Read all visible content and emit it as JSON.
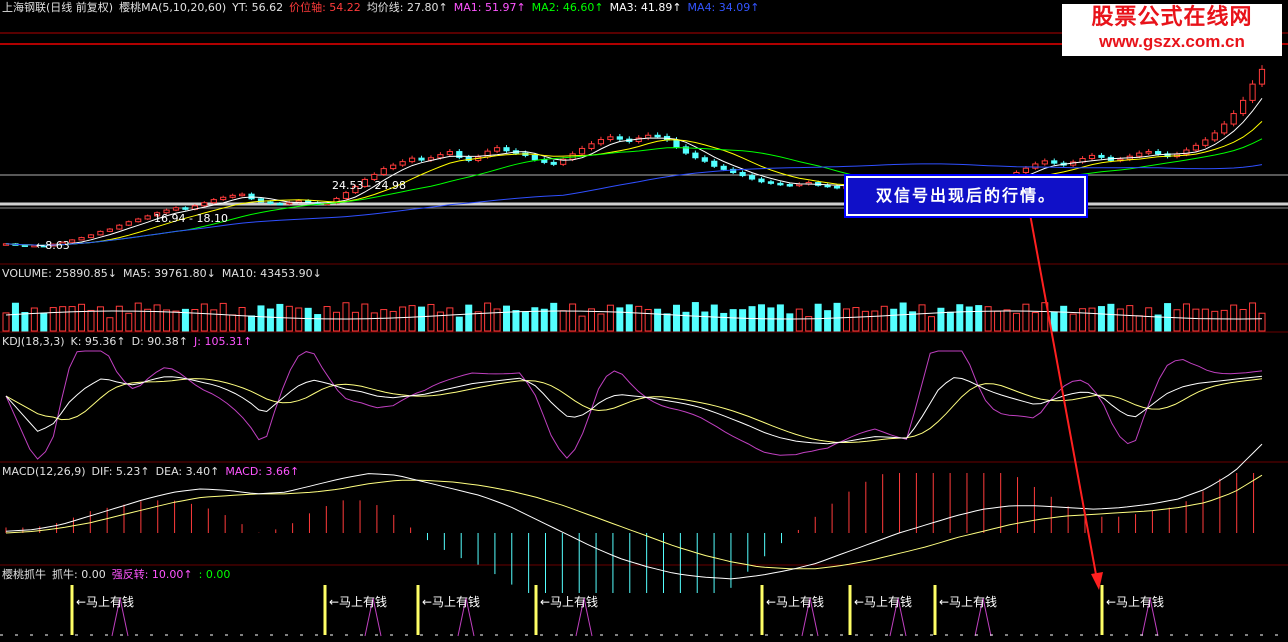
{
  "main_header": {
    "stock": "上海钢联(日线 前复权)",
    "ma_name": "樱桃MA(5,10,20,60)",
    "yt": "YT: 56.62",
    "price_axis": "价位轴: 54.22",
    "avg_line": "均价线: 27.80↑",
    "ma1": "MA1: 51.97↑",
    "ma2": "MA2: 46.60↑",
    "ma3": "MA3: 41.89↑",
    "ma4": "MA4: 34.09↑"
  },
  "price_labels": {
    "low": "←8.63",
    "box1": "16.94 - 18.10",
    "box2": "24.53 - 24.98"
  },
  "volume_header": {
    "name": "VOLUME: 25890.85↓",
    "ma5": "MA5: 39761.80↓",
    "ma10": "MA10: 43453.90↓"
  },
  "kdj_header": {
    "name": "KDJ(18,3,3)",
    "k": "K: 95.36↑",
    "d": "D: 90.38↑",
    "j": "J: 105.31↑"
  },
  "macd_header": {
    "name": "MACD(12,26,9)",
    "dif": "DIF: 5.23↑",
    "dea": "DEA: 3.40↑",
    "macd": "MACD: 3.66↑"
  },
  "signal_header": {
    "name": "樱桃抓牛",
    "zhuaniu": "抓牛: 0.00",
    "qiangfanzhuan": "强反转: 10.00↑",
    "extra": ": 0.00"
  },
  "signal_label": "←马上有钱",
  "callout": "双信号出现后的行情。",
  "watermark": {
    "line1": "股票公式在线网",
    "line2": "www.gszx.com.cn"
  },
  "colors": {
    "up": "#ff3b3b",
    "down": "#54ffff",
    "ma1": "#ffffff",
    "ma2": "#ffff00",
    "ma3": "#00ff00",
    "ma4": "#2f4fff",
    "axis": "#8b0000",
    "macd_pos": "#ff3b3b",
    "macd_neg": "#54ffff",
    "signal": "#ffff66",
    "kdj_j": "#c040c0"
  },
  "chart_data": {
    "type": "candlestick",
    "price_series_close": [
      9.2,
      8.9,
      8.7,
      8.8,
      8.63,
      9.1,
      9.6,
      10.2,
      10.8,
      11.5,
      12.4,
      13.0,
      14.0,
      14.9,
      15.6,
      16.4,
      17.2,
      17.9,
      18.5,
      18.1,
      19.0,
      19.8,
      20.6,
      21.2,
      21.7,
      22.0,
      20.8,
      20.0,
      19.6,
      19.5,
      19.9,
      20.3,
      19.8,
      19.4,
      19.7,
      20.9,
      22.4,
      24.0,
      25.8,
      27.1,
      28.6,
      29.5,
      30.4,
      31.3,
      30.8,
      31.4,
      32.2,
      33.0,
      31.5,
      30.7,
      31.6,
      33.1,
      34.0,
      33.2,
      32.6,
      32.0,
      30.9,
      30.2,
      29.7,
      31.0,
      32.4,
      33.8,
      35.0,
      36.1,
      36.8,
      36.2,
      35.6,
      36.5,
      37.2,
      36.9,
      36.0,
      34.2,
      32.6,
      31.4,
      30.5,
      29.2,
      28.4,
      27.6,
      26.8,
      25.9,
      25.2,
      24.8,
      24.5,
      24.2,
      24.6,
      25.0,
      24.3,
      24.0,
      23.6,
      23.9,
      24.6,
      25.3,
      25.8,
      26.4,
      26.0,
      25.6,
      25.4,
      25.9,
      26.5,
      25.8,
      25.3,
      24.9,
      24.6,
      24.3,
      24.8,
      25.6,
      26.5,
      27.6,
      28.7,
      29.8,
      30.6,
      30.0,
      29.5,
      30.3,
      31.2,
      32.0,
      31.5,
      30.7,
      31.0,
      31.8,
      32.6,
      33.0,
      32.4,
      31.7,
      32.3,
      33.4,
      34.6,
      36.0,
      37.8,
      40.1,
      42.8,
      46.2,
      50.4,
      54.2
    ],
    "kdj_k": [
      60,
      40,
      20,
      30,
      55,
      70,
      80,
      75,
      72,
      78,
      82,
      80,
      76,
      72,
      65,
      55,
      40,
      55,
      70,
      78,
      74,
      68,
      65,
      60,
      58,
      60,
      62,
      66,
      70,
      74,
      76,
      78,
      80,
      70,
      50,
      35,
      40,
      55,
      62,
      60,
      58,
      55,
      52,
      48,
      42,
      35,
      28,
      20,
      14,
      10,
      8,
      7,
      9,
      12,
      15,
      14,
      13,
      40,
      70,
      82,
      75,
      66,
      60,
      55,
      50,
      56,
      62,
      65,
      60,
      45,
      35,
      48,
      62,
      70,
      74,
      76,
      78,
      80,
      82
    ],
    "kdj_series_labels": [
      "K",
      "D",
      "J"
    ],
    "macd_dif": [
      0.1,
      0.2,
      0.5,
      1.0,
      1.5,
      2.0,
      2.4,
      2.6,
      2.5,
      2.3,
      2.4,
      2.8,
      3.2,
      3.5,
      3.4,
      3.0,
      2.6,
      2.2,
      1.6,
      0.8,
      0.0,
      -0.8,
      -1.5,
      -2.0,
      -2.4,
      -2.6,
      -2.7,
      -2.5,
      -2.2,
      -1.8,
      -1.2,
      -0.6,
      0.0,
      0.5,
      1.0,
      1.4,
      1.6,
      1.6,
      1.5,
      1.4,
      1.5,
      1.7,
      2.0,
      2.6,
      3.6,
      5.23
    ],
    "macd_dea": [
      0.0,
      0.1,
      0.3,
      0.6,
      1.0,
      1.4,
      1.8,
      2.1,
      2.2,
      2.3,
      2.3,
      2.4,
      2.6,
      2.9,
      3.1,
      3.1,
      3.0,
      2.8,
      2.5,
      2.1,
      1.6,
      1.0,
      0.4,
      -0.2,
      -0.8,
      -1.3,
      -1.7,
      -2.0,
      -2.1,
      -2.1,
      -1.9,
      -1.6,
      -1.2,
      -0.8,
      -0.3,
      0.1,
      0.5,
      0.8,
      1.0,
      1.1,
      1.2,
      1.3,
      1.5,
      1.8,
      2.4,
      3.4
    ],
    "signal_positions": [
      72,
      325,
      418,
      536,
      762,
      850,
      935,
      1102
    ],
    "ylim_price": [
      8.63,
      56.62
    ]
  }
}
